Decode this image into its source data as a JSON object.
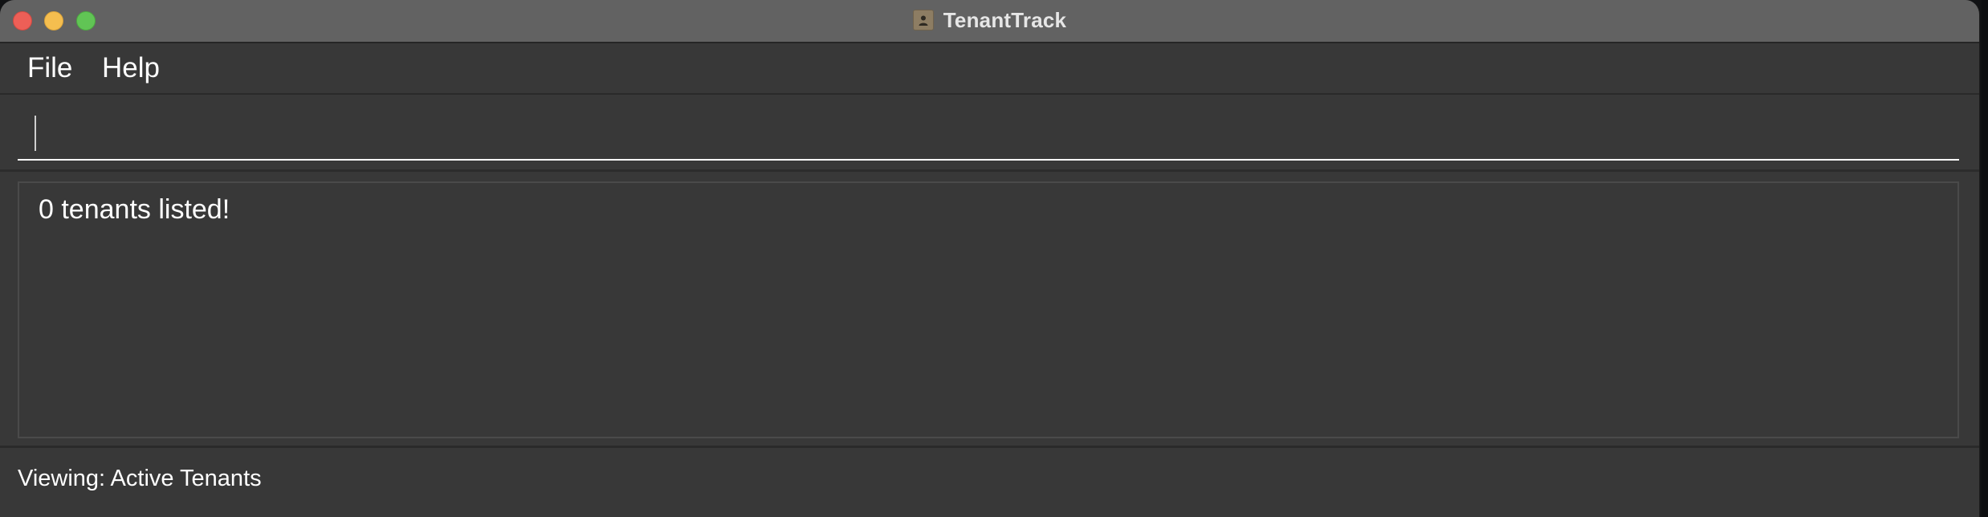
{
  "window": {
    "title": "TenantTrack",
    "app_icon": "person-badge-icon"
  },
  "titlebar_buttons": {
    "close_color": "#ed5f57",
    "minimize_color": "#f5be4f",
    "maximize_color": "#61c455"
  },
  "menu": {
    "items": [
      {
        "label": "File"
      },
      {
        "label": "Help"
      }
    ]
  },
  "command": {
    "value": "",
    "placeholder": ""
  },
  "result": {
    "message": "0 tenants listed!"
  },
  "status": {
    "text": "Viewing: Active Tenants"
  }
}
